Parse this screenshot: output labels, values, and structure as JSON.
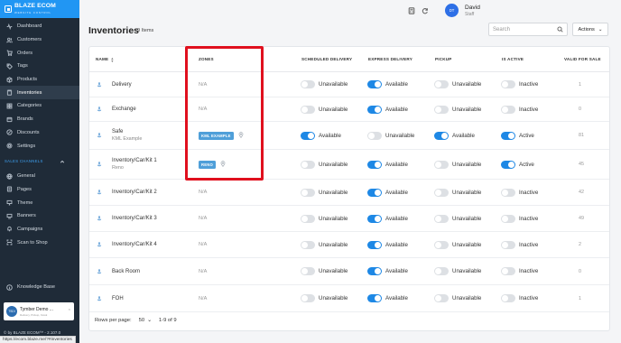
{
  "brand": {
    "name": "BLAZE ECOM",
    "sub": "WEBSITE CONTROL"
  },
  "sidebar": {
    "items": [
      {
        "label": "Dashboard",
        "icon": "pulse-icon",
        "active": false
      },
      {
        "label": "Customers",
        "icon": "people-icon",
        "active": false
      },
      {
        "label": "Orders",
        "icon": "cart-icon",
        "active": false
      },
      {
        "label": "Tags",
        "icon": "tag-icon",
        "active": false
      },
      {
        "label": "Products",
        "icon": "box-icon",
        "active": false
      },
      {
        "label": "Inventories",
        "icon": "clipboard-icon",
        "active": true
      },
      {
        "label": "Categories",
        "icon": "grid-icon",
        "active": false
      },
      {
        "label": "Brands",
        "icon": "brand-icon",
        "active": false
      },
      {
        "label": "Discounts",
        "icon": "discount-icon",
        "active": false
      },
      {
        "label": "Settings",
        "icon": "gear-icon",
        "active": false
      }
    ],
    "section_label": "SALES CHANNELS",
    "channel_items": [
      {
        "label": "General",
        "icon": "globe-icon"
      },
      {
        "label": "Pages",
        "icon": "page-icon"
      },
      {
        "label": "Theme",
        "icon": "theme-icon"
      },
      {
        "label": "Banners",
        "icon": "banner-icon"
      },
      {
        "label": "Campaigns",
        "icon": "bell-icon"
      },
      {
        "label": "Scan to Shop",
        "icon": "scan-icon"
      }
    ],
    "knowledge_base": "Knowledge Base",
    "store": {
      "avatar": "TSDI",
      "name": "Tymber Demo ...",
      "sub": "Delivery, Pickup, Kiosk"
    },
    "version": "© by BLAZE ECOM™ - 2.107.0"
  },
  "status_url": "https://ecom.blaze.me/?#inventories",
  "header": {
    "user_initials": "DT",
    "user_name": "David",
    "user_role": "Staff"
  },
  "page": {
    "title": "Inventories",
    "count": "9 Items",
    "search_placeholder": "Search",
    "actions_label": "Actions"
  },
  "table": {
    "headers": {
      "name": "NAME",
      "zones": "ZONES",
      "scheduled": "SCHEDULED DELIVERY",
      "express": "EXPRESS DELIVERY",
      "pickup": "PICKUP",
      "active": "IS ACTIVE",
      "valid": "VALID FOR SALE"
    },
    "rows": [
      {
        "name": "Delivery",
        "sub": "",
        "zone": "N/A",
        "zone_chip": false,
        "scheduled": {
          "on": false,
          "label": "Unavailable"
        },
        "express": {
          "on": true,
          "label": "Available"
        },
        "pickup": {
          "on": false,
          "label": "Unavailable"
        },
        "active": {
          "on": false,
          "label": "Inactive"
        },
        "valid": "1"
      },
      {
        "name": "Exchange",
        "sub": "",
        "zone": "N/A",
        "zone_chip": false,
        "scheduled": {
          "on": false,
          "label": "Unavailable"
        },
        "express": {
          "on": true,
          "label": "Available"
        },
        "pickup": {
          "on": false,
          "label": "Unavailable"
        },
        "active": {
          "on": false,
          "label": "Inactive"
        },
        "valid": "0"
      },
      {
        "name": "Safe",
        "sub": "KML Example",
        "zone": "KML EXAMPLE",
        "zone_chip": true,
        "scheduled": {
          "on": true,
          "label": "Available"
        },
        "express": {
          "on": false,
          "label": "Unavailable"
        },
        "pickup": {
          "on": true,
          "label": "Available"
        },
        "active": {
          "on": true,
          "label": "Active"
        },
        "valid": "81"
      },
      {
        "name": "Inventory/Car/Kit 1",
        "sub": "Reno",
        "zone": "RENO",
        "zone_chip": true,
        "scheduled": {
          "on": false,
          "label": "Unavailable"
        },
        "express": {
          "on": true,
          "label": "Available"
        },
        "pickup": {
          "on": false,
          "label": "Unavailable"
        },
        "active": {
          "on": true,
          "label": "Active"
        },
        "valid": "45"
      },
      {
        "name": "Inventory/Car/Kit 2",
        "sub": "",
        "zone": "N/A",
        "zone_chip": false,
        "scheduled": {
          "on": false,
          "label": "Unavailable"
        },
        "express": {
          "on": true,
          "label": "Available"
        },
        "pickup": {
          "on": false,
          "label": "Unavailable"
        },
        "active": {
          "on": false,
          "label": "Inactive"
        },
        "valid": "42"
      },
      {
        "name": "Inventory/Car/Kit 3",
        "sub": "",
        "zone": "N/A",
        "zone_chip": false,
        "scheduled": {
          "on": false,
          "label": "Unavailable"
        },
        "express": {
          "on": true,
          "label": "Available"
        },
        "pickup": {
          "on": false,
          "label": "Unavailable"
        },
        "active": {
          "on": false,
          "label": "Inactive"
        },
        "valid": "49"
      },
      {
        "name": "Inventory/Car/Kit 4",
        "sub": "",
        "zone": "N/A",
        "zone_chip": false,
        "scheduled": {
          "on": false,
          "label": "Unavailable"
        },
        "express": {
          "on": true,
          "label": "Available"
        },
        "pickup": {
          "on": false,
          "label": "Unavailable"
        },
        "active": {
          "on": false,
          "label": "Inactive"
        },
        "valid": "2"
      },
      {
        "name": "Back Room",
        "sub": "",
        "zone": "N/A",
        "zone_chip": false,
        "scheduled": {
          "on": false,
          "label": "Unavailable"
        },
        "express": {
          "on": true,
          "label": "Available"
        },
        "pickup": {
          "on": false,
          "label": "Unavailable"
        },
        "active": {
          "on": false,
          "label": "Inactive"
        },
        "valid": "0"
      },
      {
        "name": "FOH",
        "sub": "",
        "zone": "N/A",
        "zone_chip": false,
        "scheduled": {
          "on": false,
          "label": "Unavailable"
        },
        "express": {
          "on": true,
          "label": "Available"
        },
        "pickup": {
          "on": false,
          "label": "Unavailable"
        },
        "active": {
          "on": false,
          "label": "Inactive"
        },
        "valid": "1"
      }
    ],
    "pagination": {
      "label": "Rows per page:",
      "per_page": "50",
      "range": "1-9 of 9"
    }
  },
  "colors": {
    "accent": "#1e88e5",
    "sidebar_bg": "#1f2b38",
    "highlight": "#e0101e",
    "chip": "#4f9fd9"
  }
}
